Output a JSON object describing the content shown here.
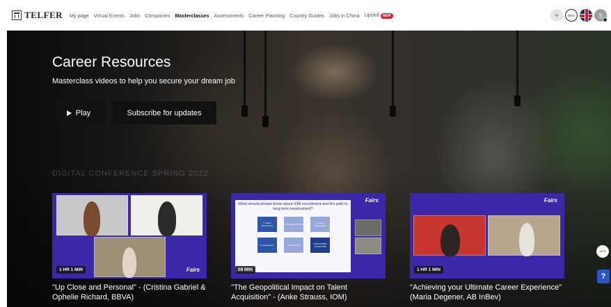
{
  "nav": {
    "logo_text": "TELFER",
    "links": [
      {
        "label": "My page"
      },
      {
        "label": "Virtual Events"
      },
      {
        "label": "Jobs"
      },
      {
        "label": "Companies"
      },
      {
        "label": "Masterclasses",
        "active": true
      },
      {
        "label": "Assessments"
      },
      {
        "label": "Career Planning"
      },
      {
        "label": "Country Guides"
      },
      {
        "label": "Jobs in China"
      },
      {
        "label": "Upskill",
        "badge": "NEW"
      }
    ],
    "right": {
      "plus": "+",
      "lang_label": "ENG",
      "flag_icon": "uk-flag-icon",
      "avatar_initial": "S"
    }
  },
  "hero": {
    "title": "Career Resources",
    "subtitle": "Masterclass videos to help you secure your dream job",
    "play_label": "Play",
    "subscribe_label": "Subscribe for updates",
    "section_label": "DIGITAL CONFERENCE SPRING 2022"
  },
  "cards": [
    {
      "title": "\"Up Close and Personal\" - (Cristina Gabriel & Ophelie Richard, BBVA)",
      "duration": "1 HR 1 MIN",
      "brand": "Fairs"
    },
    {
      "title": "\"The Geopolitical Impact on Talent Acquisition\" - (Anke Strauss, IOM)",
      "duration": "59 MIN",
      "brand": "Fairs",
      "slide_title": "What should people know about IOM recruitment and the path to long term employment?",
      "slide_boxes": [
        "1. Talent Recruitment",
        "2. Professional Track",
        "3. Junior Professional",
        "4. Assessment",
        "5. Internships",
        "ANNUALIZED VACANCIES"
      ]
    },
    {
      "title": "\"Achieving your Ultimate Career Experience\" (Maria Degener, AB InBev)",
      "duration": "1 HR 1 MIN",
      "brand": "Fairs"
    }
  ],
  "widgets": {
    "help_label": "?",
    "pill_label": "100%"
  },
  "colors": {
    "card_bg": "#3a28a6",
    "badge_red": "#d41e2c",
    "help_blue": "#2a55c9"
  }
}
